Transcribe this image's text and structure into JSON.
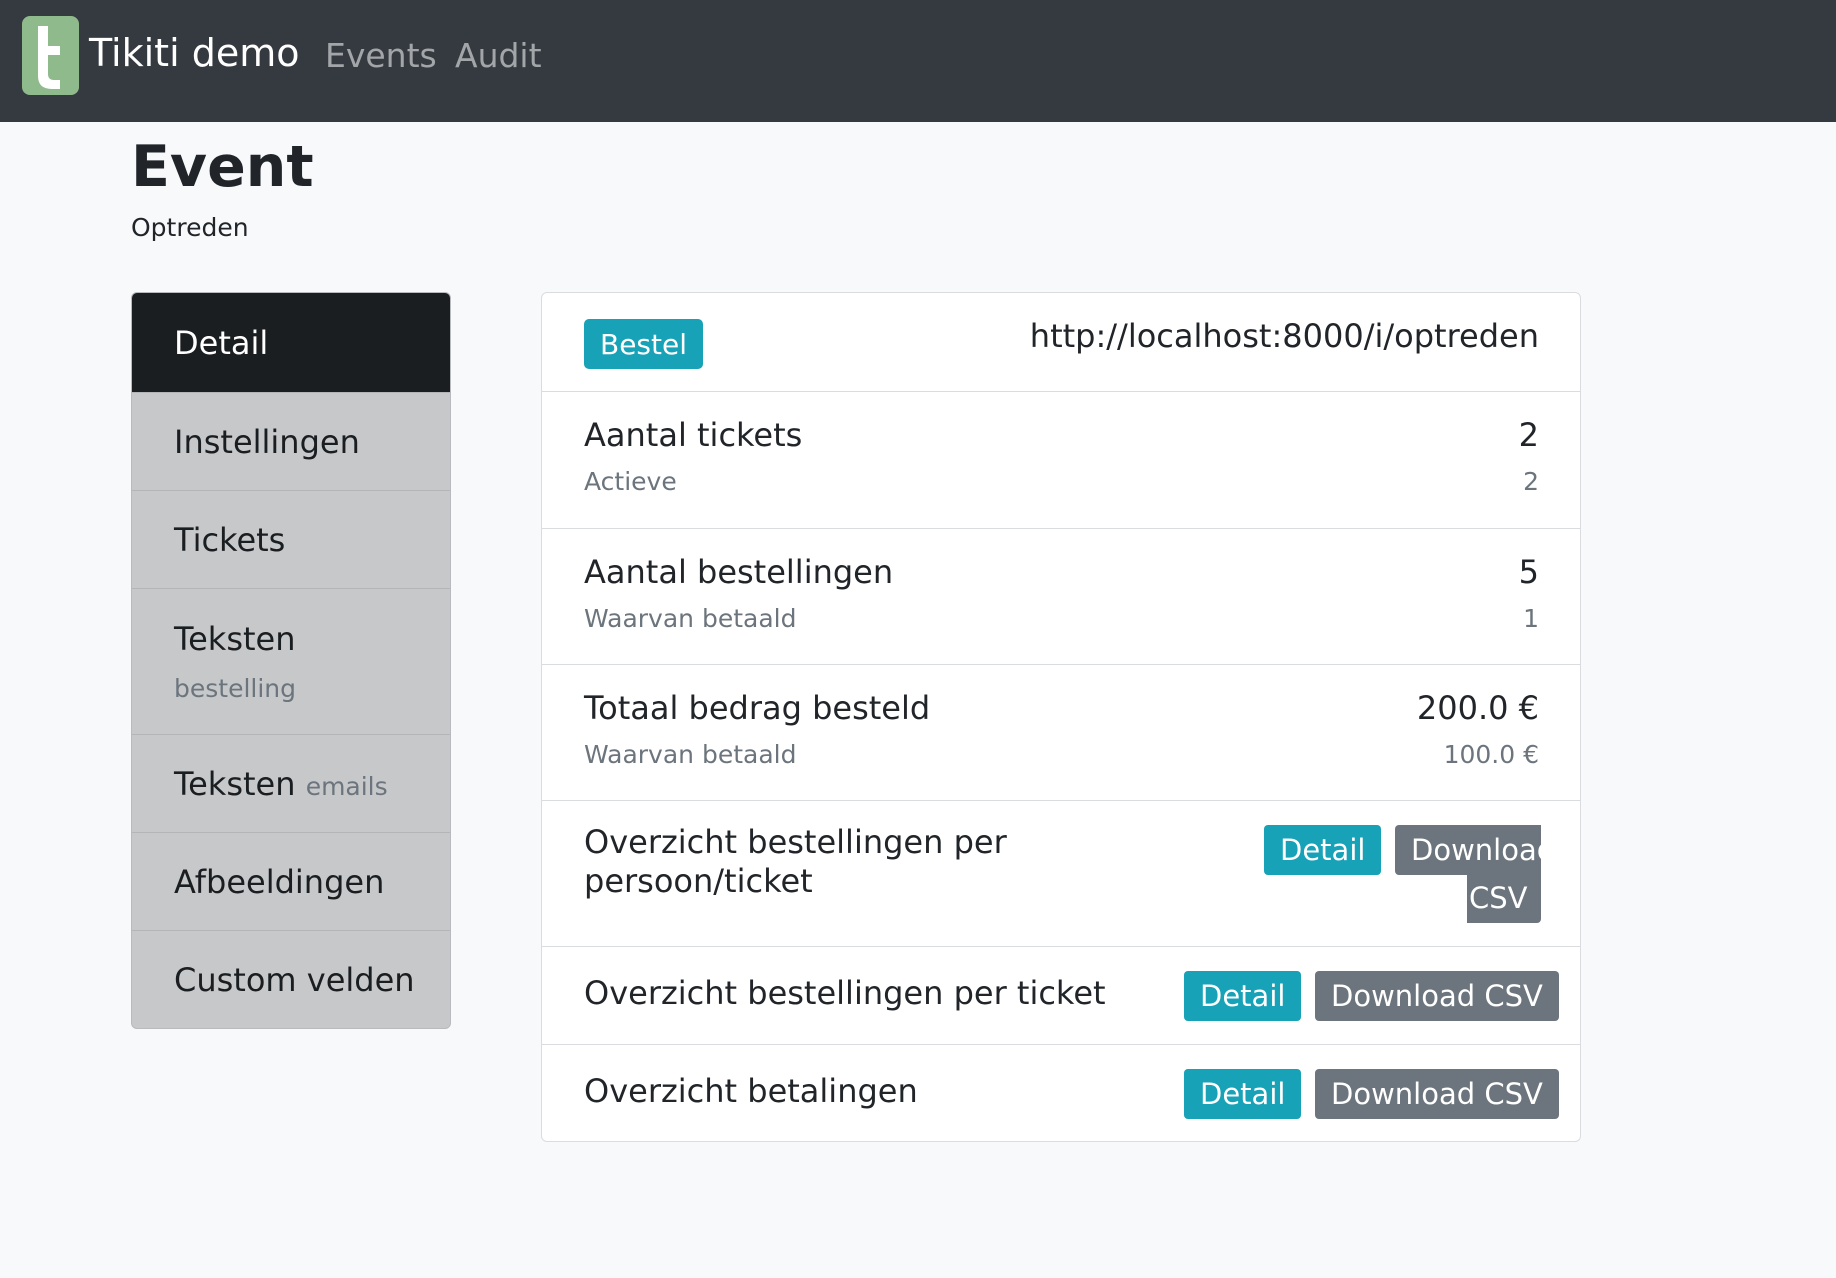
{
  "navbar": {
    "brand": "Tikiti demo",
    "links": [
      "Events",
      "Audit"
    ]
  },
  "page": {
    "title": "Event",
    "subtitle": "Optreden"
  },
  "sidebar": {
    "items": [
      {
        "label": "Detail",
        "active": true
      },
      {
        "label": "Instellingen"
      },
      {
        "label": "Tickets"
      },
      {
        "label": "Teksten",
        "small": "bestelling"
      },
      {
        "label": "Teksten",
        "small": "emails"
      },
      {
        "label": "Afbeeldingen"
      },
      {
        "label": "Custom velden"
      }
    ]
  },
  "card": {
    "order_badge": "Bestel",
    "url": "http://localhost:8000/i/optreden",
    "stats": [
      {
        "title": "Aantal tickets",
        "value": "2",
        "sub": "Actieve",
        "sub_value": "2"
      },
      {
        "title": "Aantal bestellingen",
        "value": "5",
        "sub": "Waarvan betaald",
        "sub_value": "1"
      },
      {
        "title": "Totaal bedrag besteld",
        "value": "200.0 €",
        "sub": "Waarvan betaald",
        "sub_value": "100.0 €"
      }
    ],
    "reports": [
      {
        "title_line1": "Overzicht bestellingen per",
        "title_line2": "persoon/ticket",
        "detail": "Detail",
        "csv_line1": "Download",
        "csv_line2": "CSV"
      },
      {
        "title": "Overzicht bestellingen per ticket",
        "detail": "Detail",
        "csv": "Download CSV"
      },
      {
        "title": "Overzicht betalingen",
        "detail": "Detail",
        "csv": "Download CSV"
      }
    ]
  },
  "colors": {
    "navbar": "#343a40",
    "logo": "#8fba8c",
    "info": "#17a2b8",
    "secondary": "#6c757d",
    "sidebar_active": "#1b1e21",
    "sidebar_bg": "#c6c8ca"
  }
}
